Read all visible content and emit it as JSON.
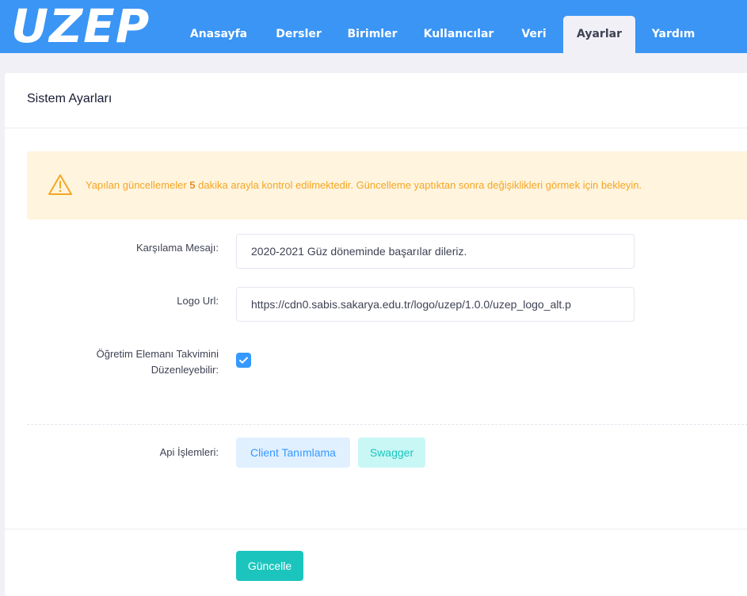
{
  "header": {
    "logo_text": "UZEP",
    "nav": [
      {
        "label": "Anasayfa"
      },
      {
        "label": "Dersler"
      },
      {
        "label": "Birimler"
      },
      {
        "label": "Kullanıcılar"
      },
      {
        "label": "Veri"
      },
      {
        "label": "Ayarlar",
        "active": true
      },
      {
        "label": "Yardım"
      }
    ]
  },
  "card": {
    "title": "Sistem Ayarları",
    "alert": {
      "text_before": "Yapılan güncellemeler ",
      "highlight": "5",
      "text_after": " dakika arayla kontrol edilmektedir. Güncelleme yaptıktan sonra değişiklikleri görmek için bekleyin.",
      "icon": "warning-triangle-icon"
    },
    "fields": {
      "welcome_label": "Karşılama Mesajı:",
      "welcome_value": "2020-2021 Güz döneminde başarılar dileriz.",
      "logo_label": "Logo Url:",
      "logo_value": "https://cdn0.sabis.sakarya.edu.tr/logo/uzep/1.0.0/uzep_logo_alt.p",
      "calendar_label_line1": "Öğretim Elemanı Takvimini",
      "calendar_label_line2": "Düzenleyebilir:",
      "calendar_checked": true,
      "api_label": "Api İşlemleri:"
    },
    "buttons": {
      "client": "Client Tanımlama",
      "swagger": "Swagger",
      "update": "Güncelle"
    }
  },
  "colors": {
    "topbar": "#3a95f5",
    "alert_bg": "#fff4de",
    "alert_text": "#f5a623",
    "primary": "#3699ff",
    "success": "#1bc5bd"
  }
}
